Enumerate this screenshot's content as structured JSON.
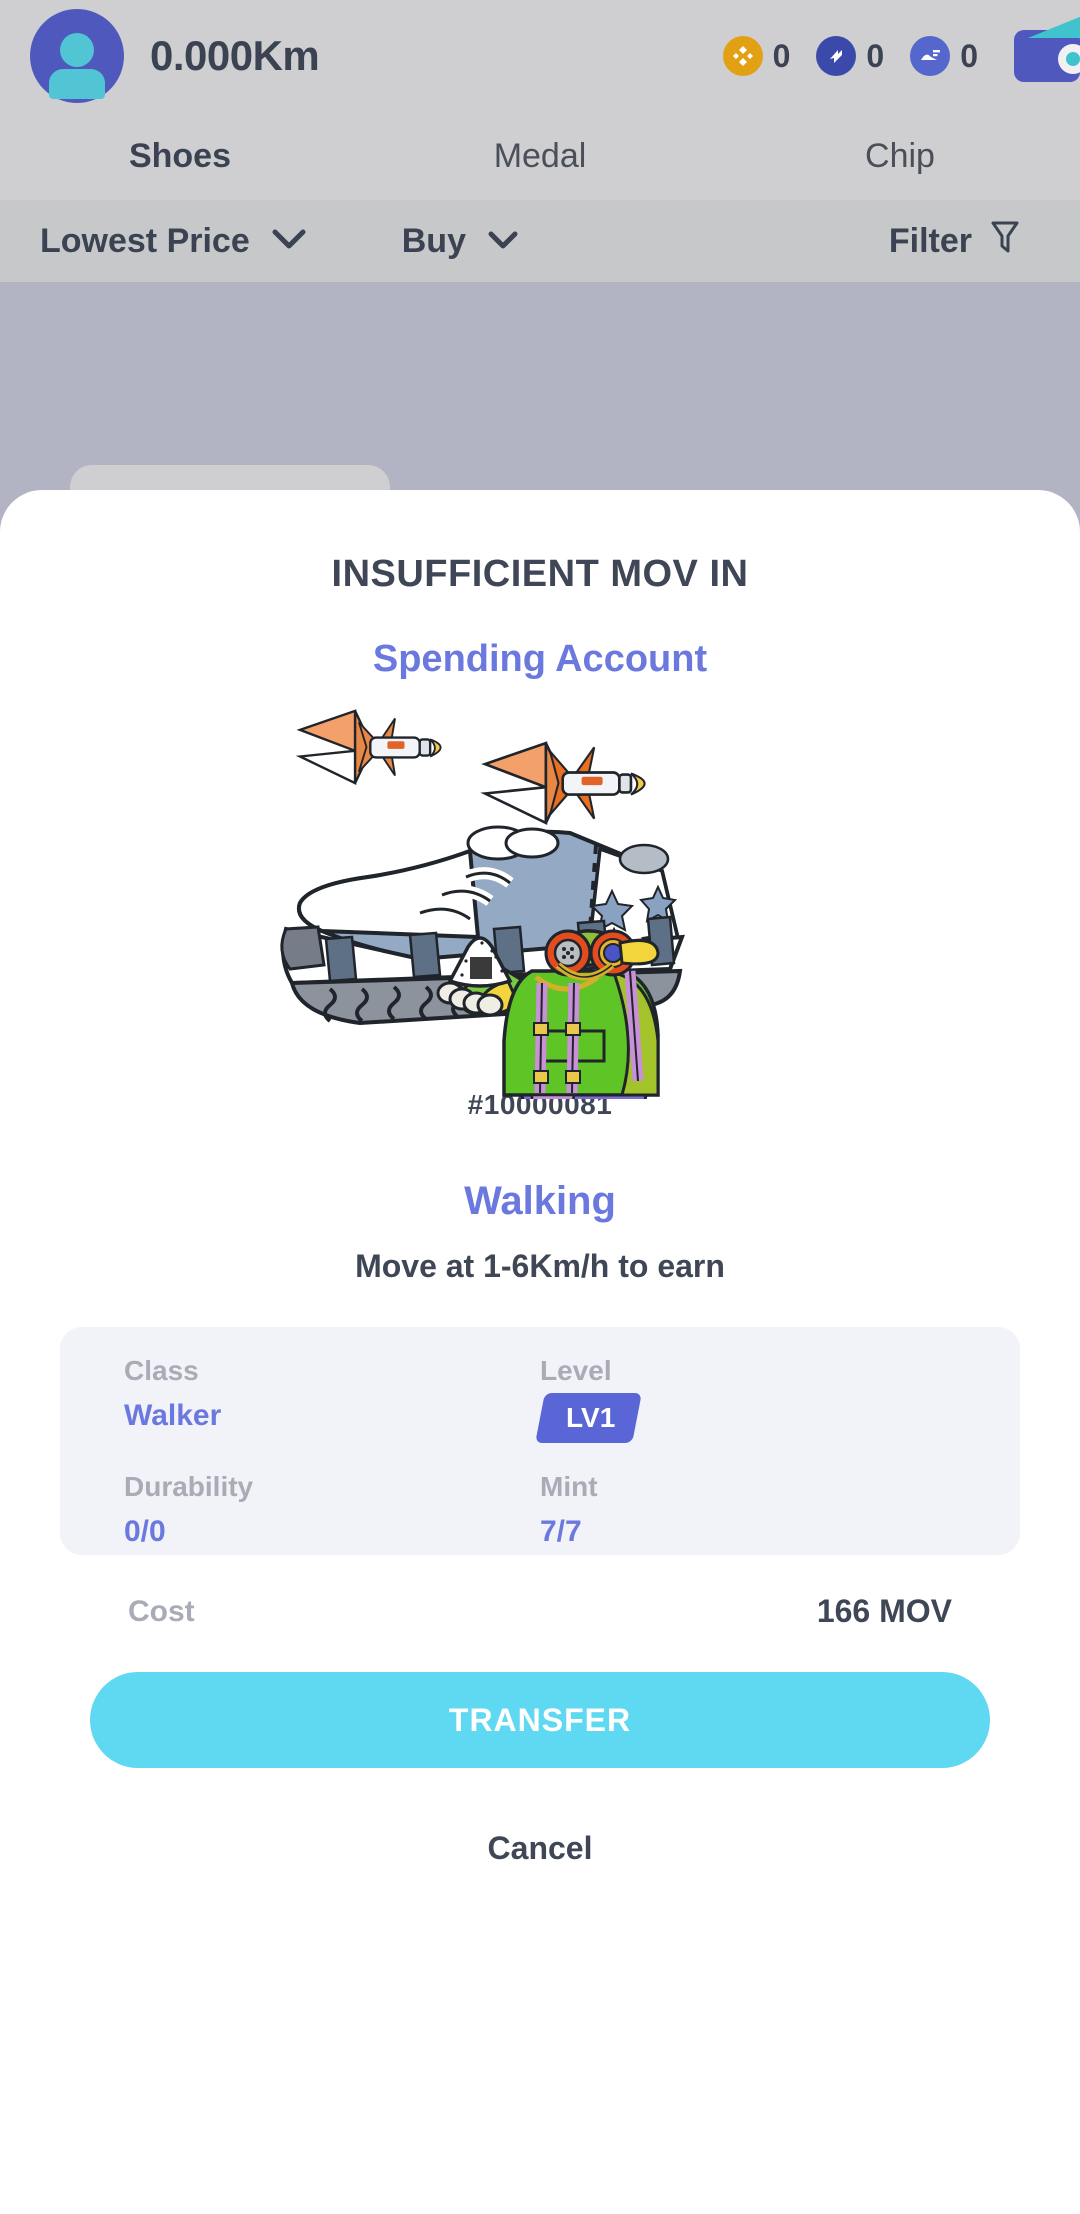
{
  "header": {
    "avatar_icon": "user-avatar-icon",
    "distance": "0.000Km",
    "currencies": [
      {
        "icon": "bnb-coin-icon",
        "symbol": "◈",
        "amount": "0",
        "color": "#e2a115"
      },
      {
        "icon": "gmt-token-icon",
        "symbol": "≫",
        "amount": "0",
        "color": "#3b49ab"
      },
      {
        "icon": "gst-token-icon",
        "symbol": "◢",
        "amount": "0",
        "color": "#5566cc"
      }
    ],
    "wallet_icon": "wallet-icon"
  },
  "tabs": [
    {
      "label": "Shoes",
      "active": true
    },
    {
      "label": "Medal",
      "active": false
    },
    {
      "label": "Chip",
      "active": false
    }
  ],
  "filter_bar": {
    "sort_label": "Lowest Price",
    "sort_chevron": "⌄",
    "buy_label": "Buy",
    "buy_chevron": "⌄",
    "filter_label": "Filter",
    "filter_icon": "funnel-icon"
  },
  "modal": {
    "title": "INSUFFICIENT MOV IN",
    "subtitle": "Spending Account",
    "artwork": {
      "shoe_icon": "sneaker-illustration",
      "character_icon": "avatar-character-illustration",
      "rocket_icon": "rocket-illustration"
    },
    "nft_id": "#10000081",
    "mode_name": "Walking",
    "mode_desc": "Move at 1-6Km/h to earn",
    "stats": [
      {
        "label": "Class",
        "value": "Walker",
        "type": "text"
      },
      {
        "label": "Level",
        "value": "LV1",
        "type": "badge"
      },
      {
        "label": "Durability",
        "value": "0/0",
        "type": "text"
      },
      {
        "label": "Mint",
        "value": "7/7",
        "type": "text"
      }
    ],
    "cost_label": "Cost",
    "cost_value": "166 MOV",
    "transfer_label": "TRANSFER",
    "cancel_label": "Cancel"
  },
  "colors": {
    "accent_blue": "#6b79df",
    "badge_blue": "#5a66d6",
    "transfer_cyan": "#5fd9f2",
    "dark_text": "#3f4656",
    "muted_text": "#a9abb6",
    "backdrop": "#b2b4c4",
    "topbar": "#cfcfd1",
    "filterbar": "#c7c8ca",
    "stats_bg": "#f1f3f8"
  }
}
